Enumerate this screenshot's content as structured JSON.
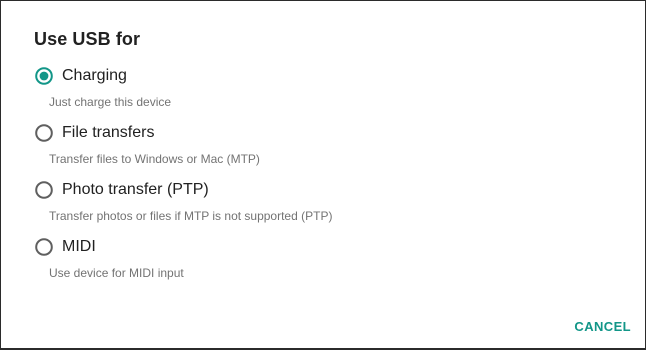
{
  "dialog": {
    "title": "Use USB for",
    "accent_color": "#129688",
    "options": [
      {
        "label": "Charging",
        "description": "Just charge this device",
        "selected": true
      },
      {
        "label": "File transfers",
        "description": "Transfer files to Windows or Mac (MTP)",
        "selected": false
      },
      {
        "label": "Photo transfer (PTP)",
        "description": "Transfer photos or files if MTP is not supported (PTP)",
        "selected": false
      },
      {
        "label": "MIDI",
        "description": "Use device for MIDI input",
        "selected": false
      }
    ],
    "cancel_label": "CANCEL"
  },
  "icons": {
    "radio_selected": "radio-selected-icon",
    "radio_unselected": "radio-unselected-icon"
  }
}
